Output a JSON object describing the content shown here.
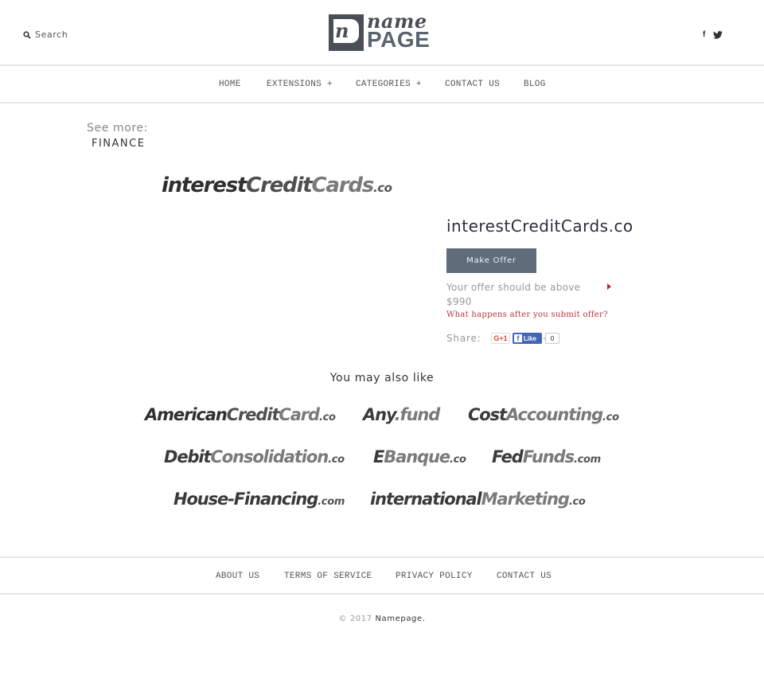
{
  "header": {
    "search_label": "Search",
    "logo": {
      "name_text": "name",
      "page_text": "PAGE",
      "mark_letter": "n"
    },
    "social": [
      {
        "icon": "facebook-icon",
        "glyph": "f"
      },
      {
        "icon": "twitter-icon"
      }
    ]
  },
  "nav": {
    "items": [
      {
        "label": "HOME"
      },
      {
        "label": "EXTENSIONS +"
      },
      {
        "label": "CATEGORIES +"
      },
      {
        "label": "CONTACT US"
      },
      {
        "label": "BLOG"
      }
    ]
  },
  "see_more": {
    "label": "See more:",
    "category": "FINANCE"
  },
  "domain": {
    "logo_parts": [
      "interest",
      "Credit",
      "Cards",
      ".co"
    ],
    "title": "interestCreditCards.co",
    "make_offer_label": "Make Offer",
    "offer_hint": "Your offer should be above $990",
    "offer_link": "What happens after you submit offer?",
    "share_label": "Share:",
    "gplus_label": "G+1",
    "fb_glyph": "f",
    "fb_like_label": "Like",
    "fb_like_count": "0"
  },
  "also_like": {
    "heading": "You may also like",
    "items": [
      {
        "parts": [
          "American",
          "Credit",
          "Card",
          ".co"
        ]
      },
      {
        "parts": [
          "Any",
          "",
          ".fund",
          ""
        ]
      },
      {
        "parts": [
          "Cost",
          "",
          "Accounting",
          ".co"
        ]
      },
      {
        "parts": [
          "Debit",
          "",
          "Consolidation",
          ".co"
        ]
      },
      {
        "parts": [
          "E",
          "",
          "Banque",
          ".co"
        ]
      },
      {
        "parts": [
          "Fed",
          "",
          "Funds",
          ".com"
        ]
      },
      {
        "parts": [
          "House-Financing",
          "",
          "",
          ".com"
        ]
      },
      {
        "parts": [
          "international",
          "",
          "Marketing",
          ".co"
        ]
      }
    ]
  },
  "footer": {
    "links": [
      {
        "label": "ABOUT US"
      },
      {
        "label": "TERMS OF SERVICE"
      },
      {
        "label": "PRIVACY POLICY"
      },
      {
        "label": "CONTACT US"
      }
    ],
    "copyright_prefix": "© 2017",
    "copyright_brand": "Namepage."
  },
  "colors": {
    "button_bg": "#5f6d7a",
    "link_red": "#b8333a",
    "divider": "#e6e6e6",
    "logo_dark": "#4a4f57"
  }
}
